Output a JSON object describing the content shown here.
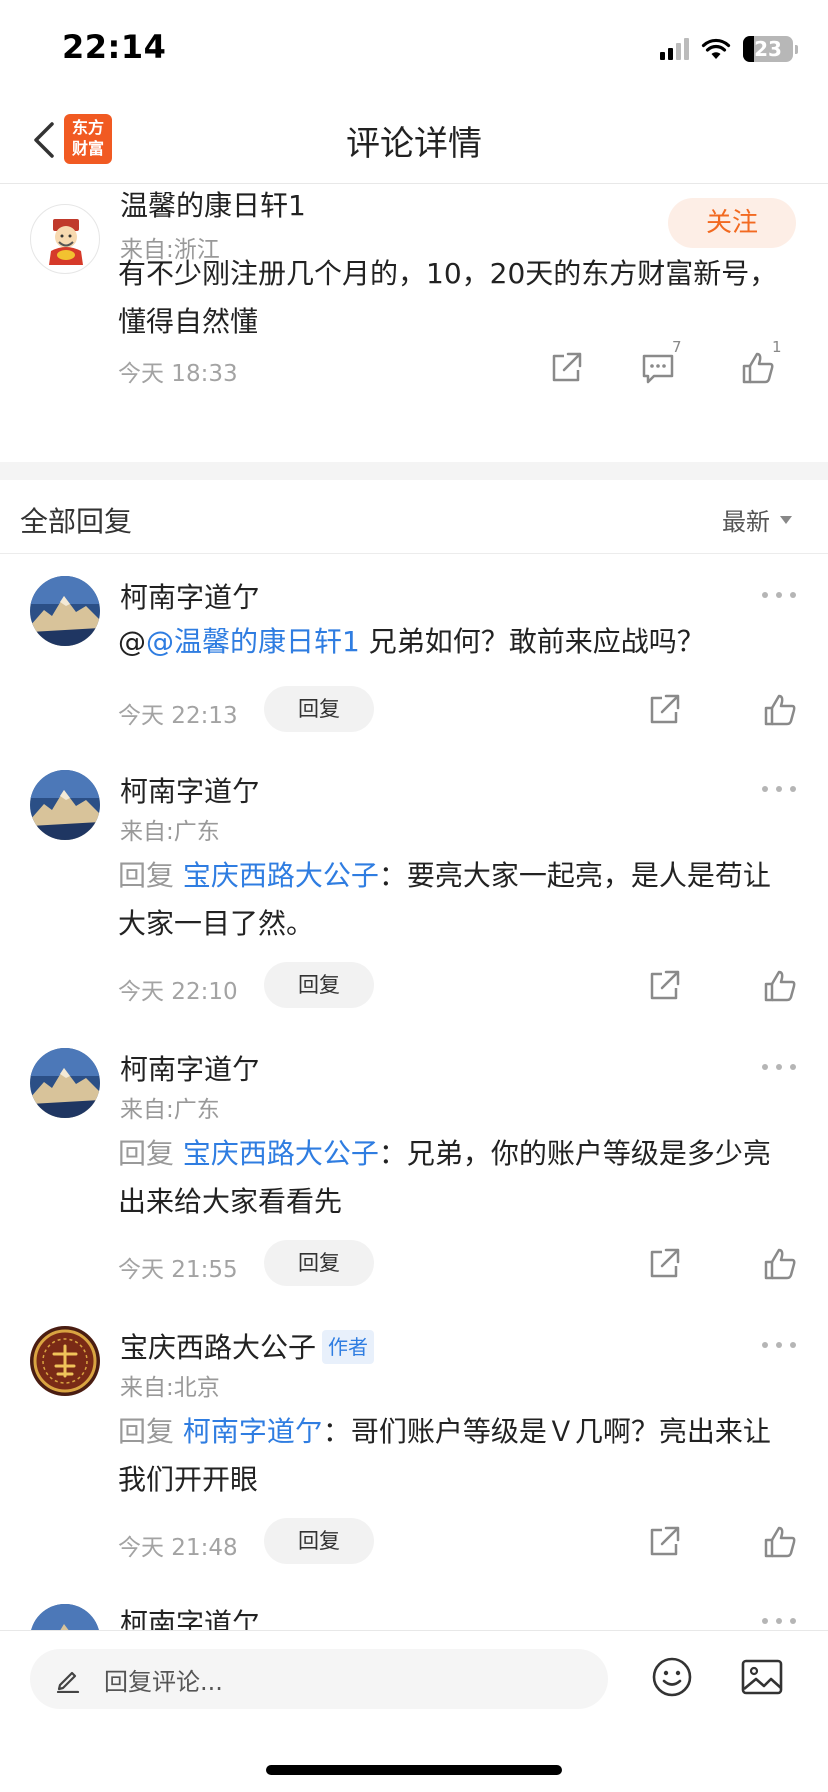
{
  "status_bar": {
    "time": "22:14",
    "battery": "23"
  },
  "nav": {
    "logo_line1": "东方",
    "logo_line2": "财富",
    "title": "评论详情"
  },
  "main_comment": {
    "user": "温馨的康日轩1",
    "from": "来自:浙江",
    "follow_label": "关注",
    "text": "有不少刚注册几个月的，10，20天的东方财富新号，懂得自然懂",
    "time": "今天 18:33",
    "comment_count": "7",
    "like_count": "1"
  },
  "replies_header": {
    "title": "全部回复",
    "sort": "最新"
  },
  "replies": [
    {
      "user": "柯南字道亇",
      "from": "",
      "prefix": "@",
      "target": "@温馨的康日轩1",
      "body": " 兄弟如何？敢前来应战吗？",
      "time": "今天 22:13",
      "reply_label": "回复"
    },
    {
      "user": "柯南字道亇",
      "from": "来自:广东",
      "prefix": "回复 ",
      "target": "宝庆西路大公子",
      "body": "：要亮大家一起亮，是人是苟让大家一目了然。",
      "time": "今天 22:10",
      "reply_label": "回复"
    },
    {
      "user": "柯南字道亇",
      "from": "来自:广东",
      "prefix": "回复 ",
      "target": "宝庆西路大公子",
      "body": "：兄弟，你的账户等级是多少亮出来给大家看看先",
      "time": "今天 21:55",
      "reply_label": "回复"
    },
    {
      "user": "宝庆西路大公子",
      "badge": "作者",
      "from": "来自:北京",
      "prefix": "回复 ",
      "target": "柯南字道亇",
      "body": "：哥们账户等级是Ｖ几啊？亮出来让我们开开眼",
      "time": "今天 21:48",
      "reply_label": "回复"
    },
    {
      "user": "柯南字道亇"
    }
  ],
  "bottom_bar": {
    "placeholder": "回复评论..."
  },
  "colors": {
    "accent": "#f26a21",
    "link": "#2f7de1",
    "muted": "#999999"
  }
}
